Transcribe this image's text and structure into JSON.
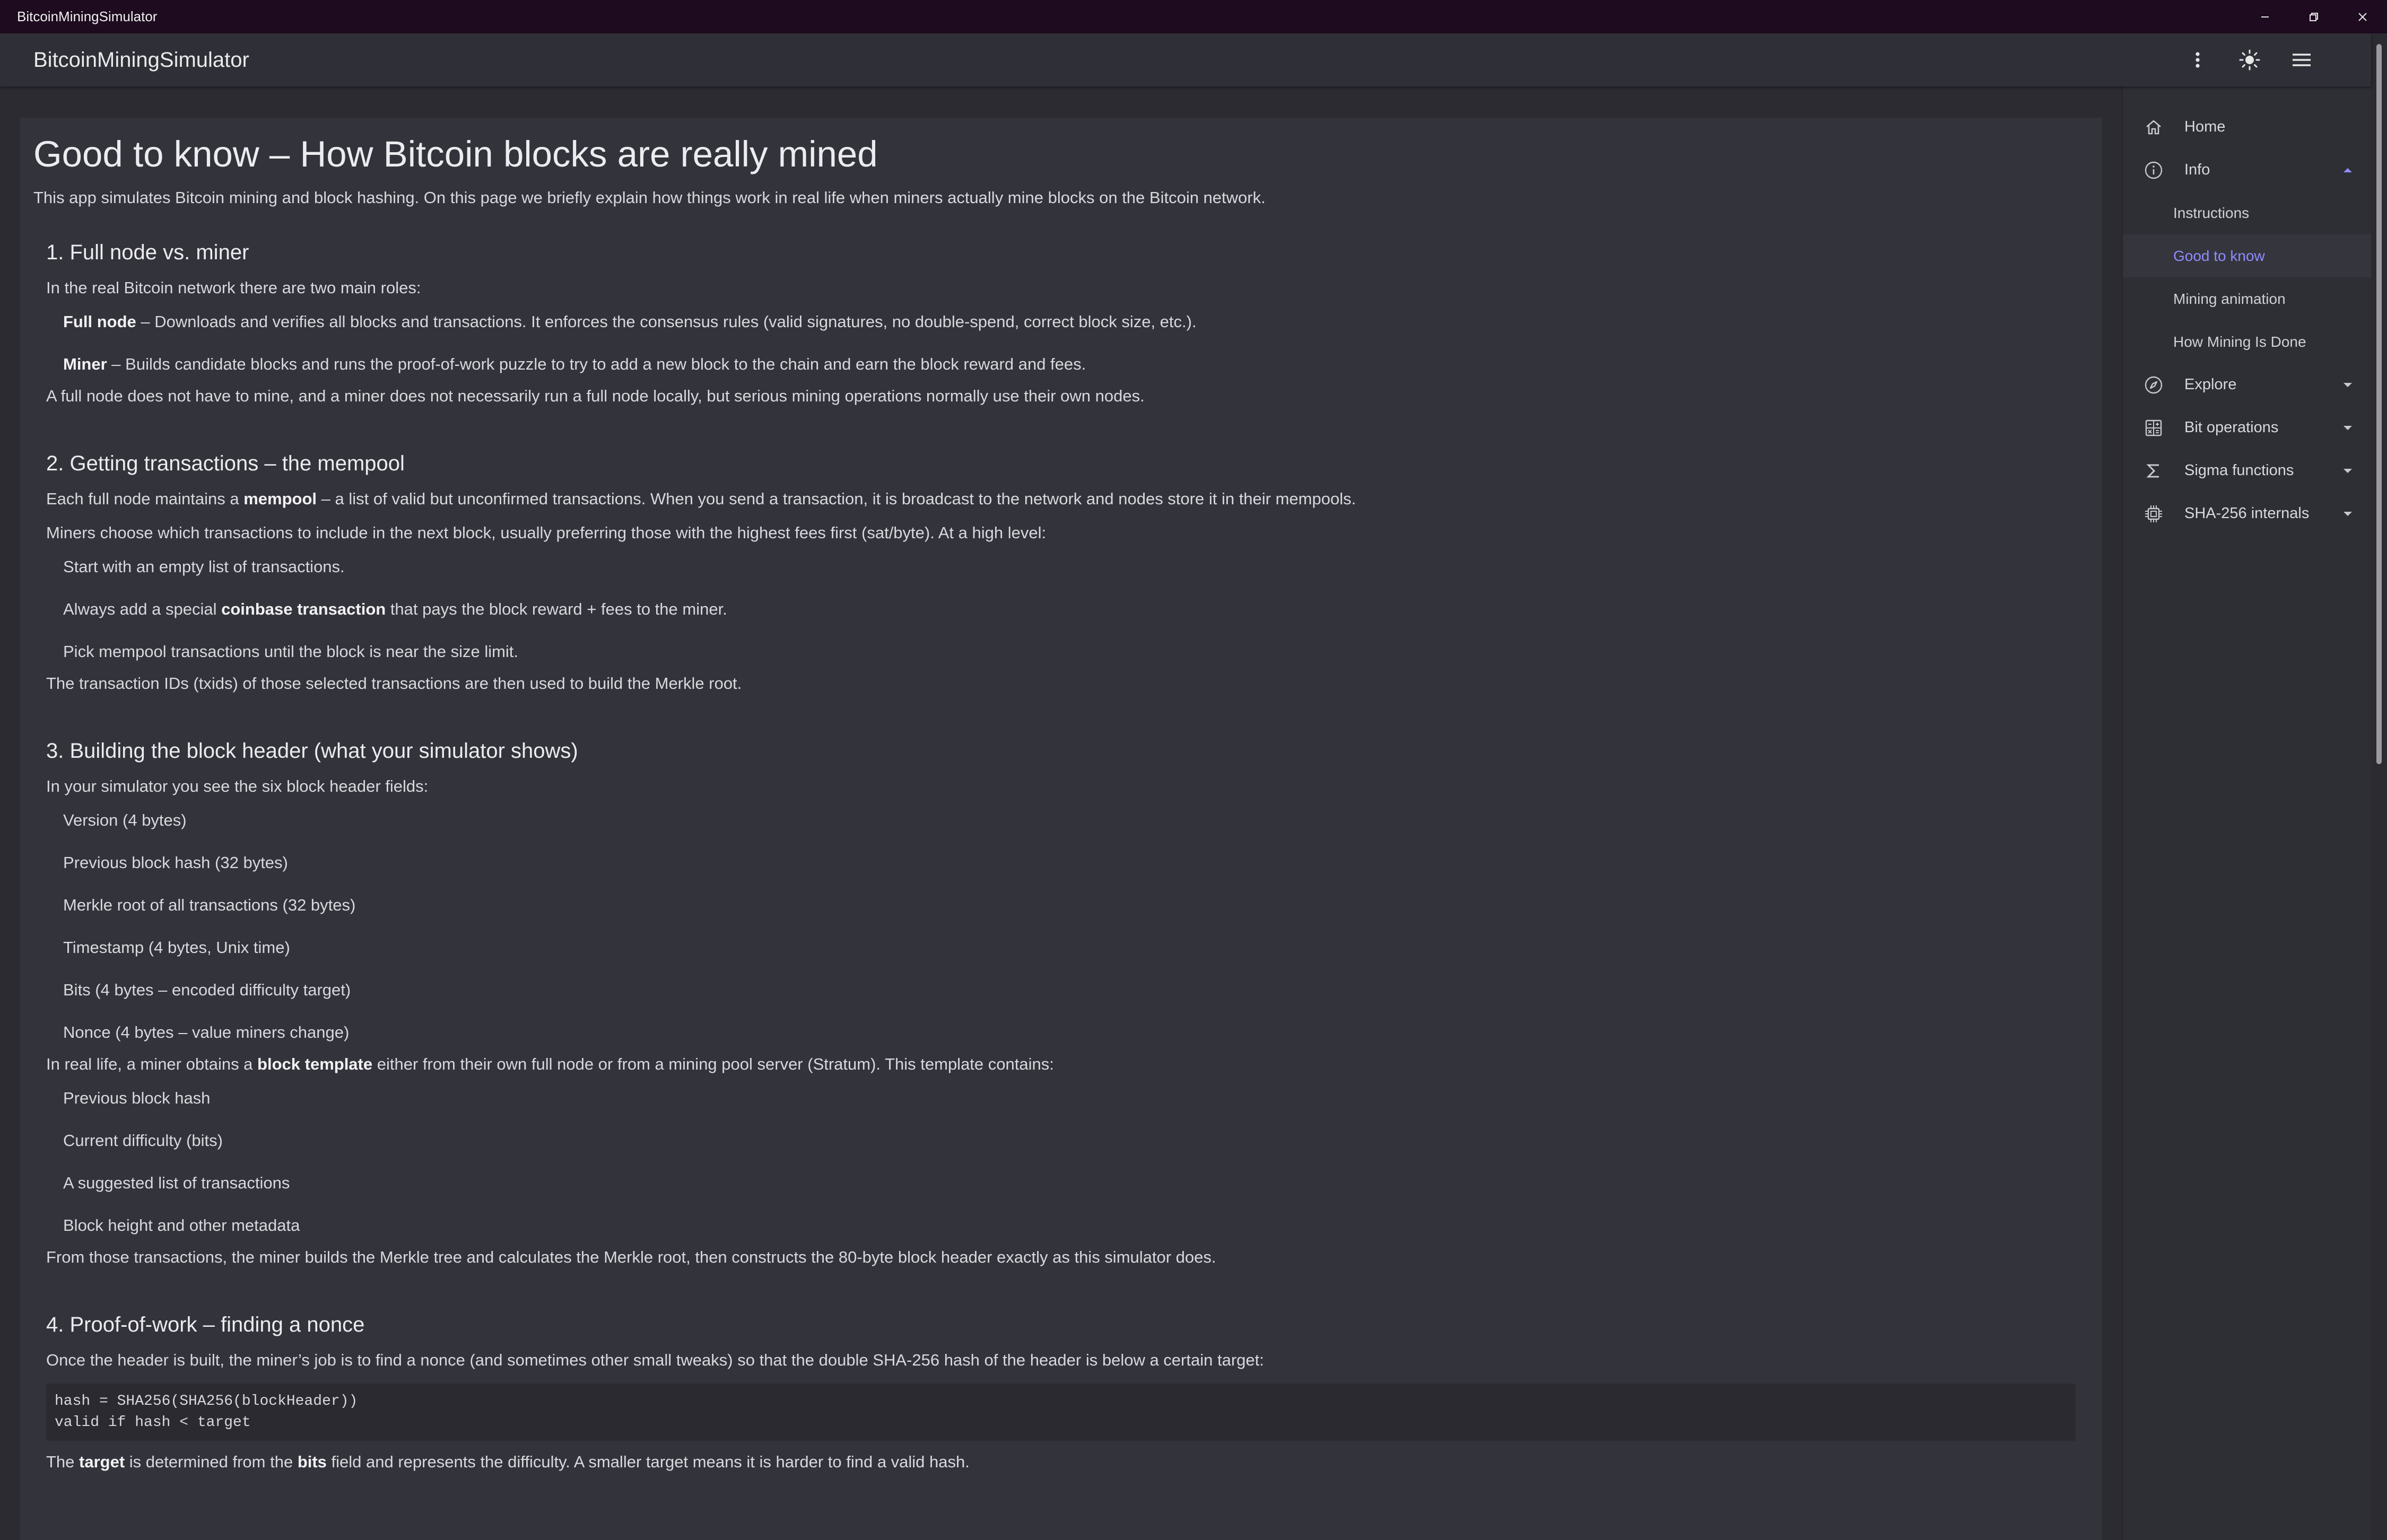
{
  "window": {
    "title": "BitcoinMiningSimulator",
    "controls": {
      "minimize": "minimize-icon",
      "restore": "restore-icon",
      "close": "close-icon"
    }
  },
  "appbar": {
    "title": "BitcoinMiningSimulator",
    "icons": [
      "more-vert-icon",
      "brightness-icon",
      "menu-icon"
    ]
  },
  "nav": {
    "accent_color": "#8f8cff",
    "home": "Home",
    "info": "Info",
    "info_sub": [
      "Instructions",
      "Good to know",
      "Mining animation",
      "How Mining Is Done"
    ],
    "active_sub": "Good to know",
    "explore": "Explore",
    "bitops": "Bit operations",
    "sigma": "Sigma functions",
    "sha": "SHA-256 internals"
  },
  "page": {
    "title": "Good to know – How Bitcoin blocks are really mined",
    "intro": "This app simulates Bitcoin mining and block hashing. On this page we briefly explain how things work in real life when miners actually mine blocks on the Bitcoin network.",
    "s1": {
      "heading": "1. Full node vs. miner",
      "p1": "In the real Bitcoin network there are two main roles:",
      "items": [
        {
          "b": "Full node",
          "t": " – Downloads and verifies all blocks and transactions. It enforces the consensus rules (valid signatures, no double-spend, correct block size, etc.)."
        },
        {
          "b": "Miner",
          "t": " – Builds candidate blocks and runs the proof-of-work puzzle to try to add a new block to the chain and earn the block reward and fees."
        }
      ],
      "p2": "A full node does not have to mine, and a miner does not necessarily run a full node locally, but serious mining operations normally use their own nodes."
    },
    "s2": {
      "heading": "2. Getting transactions – the mempool",
      "p1_pre": "Each full node maintains a ",
      "p1_b": "mempool",
      "p1_post": " – a list of valid but unconfirmed transactions. When you send a transaction, it is broadcast to the network and nodes store it in their mempools.",
      "p2": "Miners choose which transactions to include in the next block, usually preferring those with the highest fees first (sat/byte). At a high level:",
      "li1": "Start with an empty list of transactions.",
      "li2_pre": "Always add a special ",
      "li2_b": "coinbase transaction",
      "li2_post": " that pays the block reward + fees to the miner.",
      "li3": "Pick mempool transactions until the block is near the size limit.",
      "p3": "The transaction IDs (txids) of those selected transactions are then used to build the Merkle root."
    },
    "s3": {
      "heading": "3. Building the block header (what your simulator shows)",
      "p1": "In your simulator you see the six block header fields:",
      "fields": [
        "Version (4 bytes)",
        "Previous block hash (32 bytes)",
        "Merkle root of all transactions (32 bytes)",
        "Timestamp (4 bytes, Unix time)",
        "Bits (4 bytes – encoded difficulty target)",
        "Nonce (4 bytes – value miners change)"
      ],
      "p2_pre": "In real life, a miner obtains a ",
      "p2_b": "block template",
      "p2_post": " either from their own full node or from a mining pool server (Stratum). This template contains:",
      "template": [
        "Previous block hash",
        "Current difficulty (bits)",
        "A suggested list of transactions",
        "Block height and other metadata"
      ],
      "p3": "From those transactions, the miner builds the Merkle tree and calculates the Merkle root, then constructs the 80-byte block header exactly as this simulator does."
    },
    "s4": {
      "heading": "4. Proof-of-work – finding a nonce",
      "p1": "Once the header is built, the miner’s job is to find a nonce (and sometimes other small tweaks) so that the double SHA-256 hash of the header is below a certain target:",
      "code1": "hash = SHA256(SHA256(blockHeader))",
      "code2": "valid if hash < target",
      "p2_a": "The ",
      "p2_b1": "target",
      "p2_c": " is determined from the ",
      "p2_b2": "bits",
      "p2_d": " field and represents the difficulty. A smaller target means it is harder to find a valid hash."
    }
  }
}
